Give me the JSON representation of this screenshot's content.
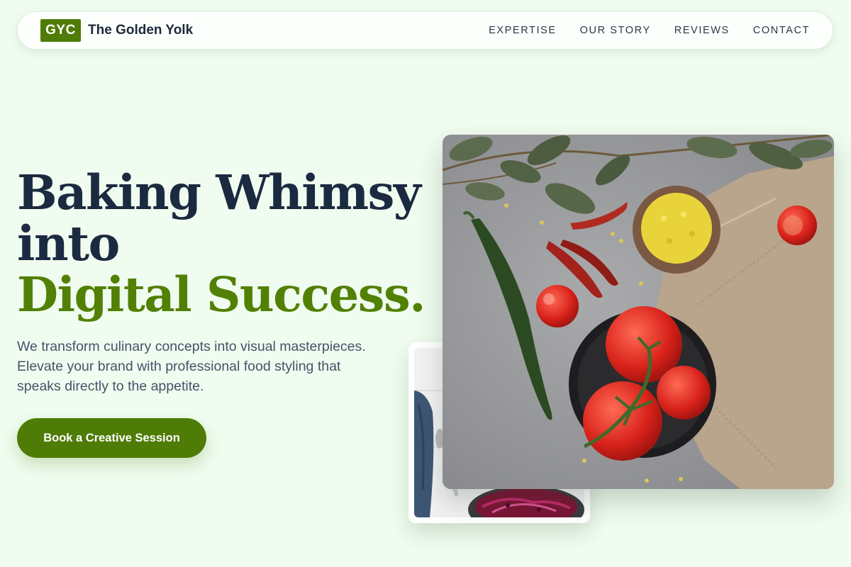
{
  "nav": {
    "logo_badge": "GYC",
    "brand_name": "The Golden Yolk",
    "links": [
      "EXPERTISE",
      "OUR STORY",
      "REVIEWS",
      "CONTACT"
    ]
  },
  "hero": {
    "headline_line1": "Baking Whimsy",
    "headline_line2": "into",
    "headline_accent": "Digital Success.",
    "subtext": "We transform culinary concepts into visual masterpieces. Elevate your brand with professional food styling that speaks directly to the appetite.",
    "cta_label": "Book a Creative Session",
    "main_image_alt": "Flat lay of tomatoes, chili peppers, eucalyptus leaves and a linen napkin on grey stone",
    "secondary_image_alt": "Pot of red cabbage and beets on a white wooden table"
  },
  "colors": {
    "background": "#effcef",
    "brand_green": "#4f7c06",
    "accent_green": "#528005",
    "heading": "#1b2a40",
    "body_text": "#45536a"
  }
}
